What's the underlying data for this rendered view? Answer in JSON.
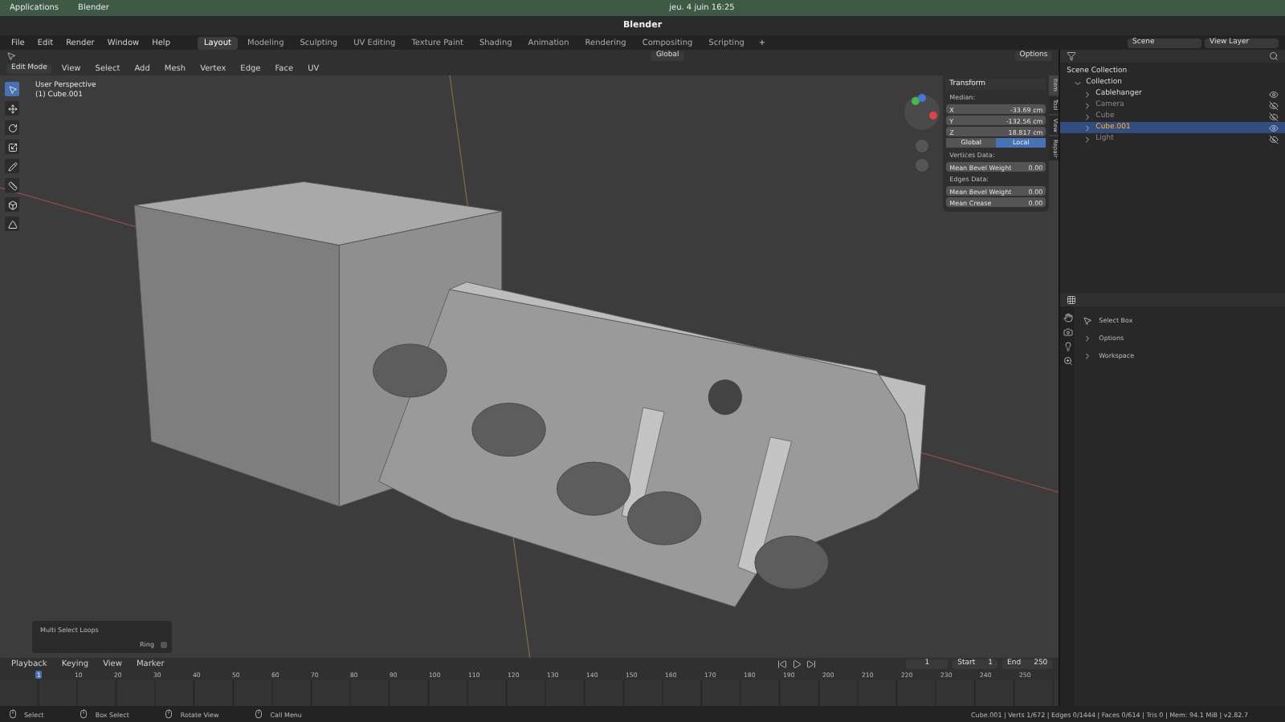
{
  "system_bar": {
    "apps": "Applications",
    "app": "Blender",
    "clock": "jeu. 4 juin 16:25"
  },
  "window": {
    "title": "Blender"
  },
  "menu": [
    "File",
    "Edit",
    "Render",
    "Window",
    "Help"
  ],
  "workspaces": [
    {
      "label": "Layout",
      "selected": true
    },
    {
      "label": "Modeling",
      "selected": false
    },
    {
      "label": "Sculpting",
      "selected": false
    },
    {
      "label": "UV Editing",
      "selected": false
    },
    {
      "label": "Texture Paint",
      "selected": false
    },
    {
      "label": "Shading",
      "selected": false
    },
    {
      "label": "Animation",
      "selected": false
    },
    {
      "label": "Rendering",
      "selected": false
    },
    {
      "label": "Compositing",
      "selected": false
    },
    {
      "label": "Scripting",
      "selected": false
    }
  ],
  "add_workspace": "+",
  "scene": {
    "scene": "Scene",
    "view_layer": "View Layer"
  },
  "tool_header": {
    "orientation": "Global",
    "options": "Options"
  },
  "header": {
    "mode": "Edit Mode",
    "menus": [
      "View",
      "Select",
      "Add",
      "Mesh",
      "Vertex",
      "Edge",
      "Face",
      "UV"
    ]
  },
  "viewport": {
    "perspective": "User Perspective",
    "object": "(1) Cube.001"
  },
  "sidebar": {
    "tabs": [
      {
        "label": "Item",
        "selected": true
      },
      {
        "label": "Tool",
        "selected": false
      },
      {
        "label": "View",
        "selected": false
      },
      {
        "label": "Repair",
        "selected": false
      }
    ],
    "panel": "Transform",
    "median": "Median:",
    "coords": [
      {
        "axis": "X",
        "value": "-33.69 cm"
      },
      {
        "axis": "Y",
        "value": "-132.56 cm"
      },
      {
        "axis": "Z",
        "value": "18.817 cm"
      }
    ],
    "space": [
      {
        "label": "Global",
        "selected": false
      },
      {
        "label": "Local",
        "selected": true
      }
    ],
    "groups": [
      {
        "title": "Vertices Data:",
        "rows": [
          {
            "label": "Mean Bevel Weight",
            "value": "0.00"
          }
        ]
      },
      {
        "title": "Edges Data:",
        "rows": [
          {
            "label": "Mean Bevel Weight",
            "value": "0.00"
          },
          {
            "label": "Mean Crease",
            "value": "0.00"
          }
        ]
      }
    ]
  },
  "last_operator": {
    "title": "Multi Select Loops",
    "option": "Ring",
    "checked": false
  },
  "timeline": {
    "menus": [
      "Playback",
      "Keying",
      "View",
      "Marker"
    ],
    "frame": "1",
    "start_label": "Start",
    "start": "1",
    "end_label": "End",
    "end": "250",
    "ticks": [
      "1",
      "10",
      "20",
      "30",
      "40",
      "50",
      "60",
      "70",
      "80",
      "90",
      "100",
      "110",
      "120",
      "130",
      "140",
      "150",
      "160",
      "170",
      "180",
      "190",
      "200",
      "210",
      "220",
      "230",
      "240",
      "250"
    ]
  },
  "outliner": {
    "root": "Scene Collection",
    "collection": "Collection",
    "items": [
      {
        "name": "Cablehanger",
        "selected": false,
        "hidden": false
      },
      {
        "name": "Camera",
        "selected": false,
        "hidden": true
      },
      {
        "name": "Cube",
        "selected": false,
        "hidden": true
      },
      {
        "name": "Cube.001",
        "selected": true,
        "hidden": false
      },
      {
        "name": "Light",
        "selected": false,
        "hidden": true
      }
    ]
  },
  "properties": {
    "tool": "Select Box",
    "sections": [
      "Options",
      "Workspace"
    ]
  },
  "status_bar": {
    "hints": [
      "Select",
      "Box Select",
      "Rotate View",
      "Call Menu"
    ],
    "stats": "Cube.001 | Verts 1/672 | Edges 0/1444 | Faces 0/614 | Tris 0 | Mem: 94.1 MiB | v2.82.7"
  }
}
